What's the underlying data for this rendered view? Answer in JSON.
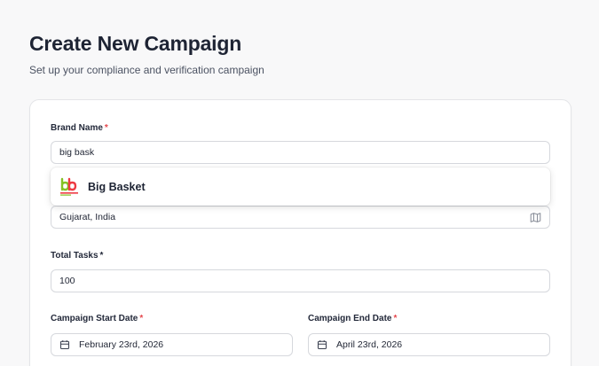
{
  "header": {
    "title": "Create New Campaign",
    "subtitle": "Set up your compliance and verification campaign"
  },
  "form": {
    "brand_name": {
      "label": "Brand Name",
      "required_mark": "*",
      "value": "big bask"
    },
    "brand_suggestions": [
      {
        "name": "Big Basket",
        "logo": "bigbasket-logo",
        "logo_text": "bigbasket"
      }
    ],
    "location": {
      "value": "Gujarat, India",
      "icon": "map-icon"
    },
    "total_tasks": {
      "label": "Total Tasks",
      "required_mark": "*",
      "value": "100"
    },
    "start_date": {
      "label": "Campaign Start Date",
      "required_mark": "*",
      "value": "February 23rd, 2026",
      "icon": "calendar-icon"
    },
    "end_date": {
      "label": "Campaign End Date",
      "required_mark": "*",
      "value": "April 23rd, 2026",
      "icon": "calendar-icon"
    }
  },
  "colors": {
    "background": "#f8f8f9",
    "required": "#e5484d",
    "logo_green": "#84c225",
    "logo_red": "#ee3a43"
  }
}
